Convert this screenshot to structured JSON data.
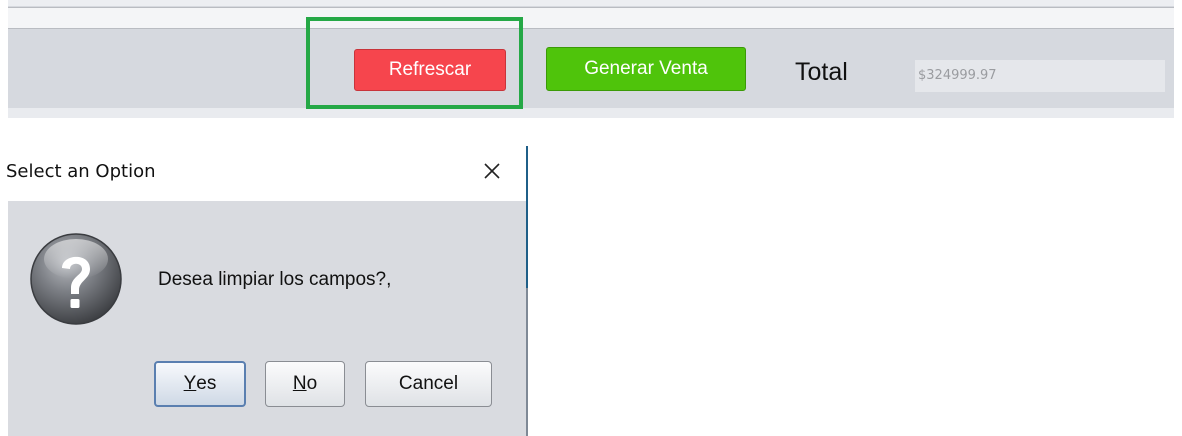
{
  "toolbar": {
    "refresh_label": "Refrescar",
    "generate_sale_label": "Generar Venta",
    "total_label": "Total",
    "total_value": "$324999.97"
  },
  "dialog": {
    "title": "Select an Option",
    "message": "Desea limpiar los campos?,",
    "buttons": {
      "yes": {
        "mnemonic": "Y",
        "rest": "es"
      },
      "no": {
        "mnemonic": "N",
        "rest": "o"
      },
      "cancel": "Cancel"
    }
  },
  "colors": {
    "refresh_button": "#f6454d",
    "generate_sale_button": "#4fc40b",
    "highlight": "#25a846",
    "dialog_bg": "#d9dbe0"
  },
  "icons": {
    "close": "close-icon",
    "question": "question-icon"
  }
}
